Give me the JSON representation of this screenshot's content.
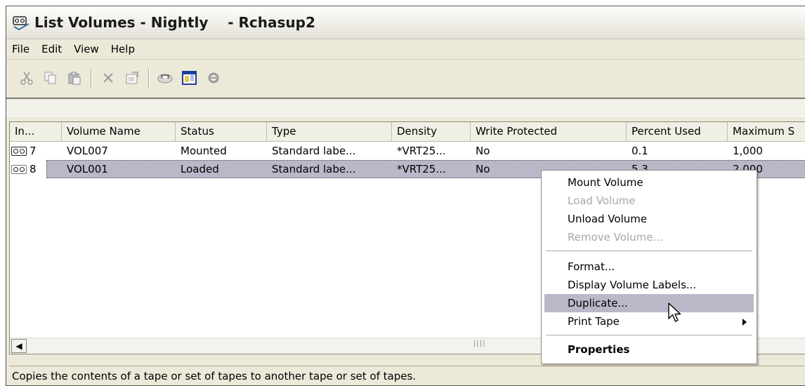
{
  "window": {
    "title": "List Volumes - Nightly    - Rchasup2"
  },
  "menu": [
    {
      "label": "File"
    },
    {
      "label": "Edit"
    },
    {
      "label": "View"
    },
    {
      "label": "Help"
    }
  ],
  "toolbar": {
    "buttons": [
      {
        "icon": "cut-icon"
      },
      {
        "icon": "copy-icon"
      },
      {
        "icon": "paste-icon"
      },
      {
        "icon": "delete-icon"
      },
      {
        "icon": "properties-icon"
      },
      {
        "icon": "tape-icon"
      },
      {
        "icon": "columns-icon"
      },
      {
        "icon": "stop-icon"
      }
    ]
  },
  "table": {
    "columns": [
      {
        "label": "In..."
      },
      {
        "label": "Volume Name"
      },
      {
        "label": "Status"
      },
      {
        "label": "Type"
      },
      {
        "label": "Density"
      },
      {
        "label": "Write Protected"
      },
      {
        "label": "Percent Used"
      },
      {
        "label": "Maximum S"
      }
    ],
    "rows": [
      {
        "index": "7",
        "volume": "VOL007",
        "status": "Mounted",
        "type": "Standard labe...",
        "density": "*VRT25...",
        "write_protected": "No",
        "percent_used": "0.1",
        "maximum": "1,000"
      },
      {
        "index": "8",
        "volume": "VOL001",
        "status": "Loaded",
        "type": "Standard labe...",
        "density": "*VRT25...",
        "write_protected": "No",
        "percent_used": "5.3",
        "maximum": "2,000"
      }
    ],
    "selected_row": 1
  },
  "context_menu": {
    "group1": [
      {
        "label": "Mount Volume",
        "enabled": true
      },
      {
        "label": "Load Volume",
        "enabled": false
      },
      {
        "label": "Unload Volume",
        "enabled": true
      },
      {
        "label": "Remove Volume...",
        "enabled": false
      }
    ],
    "group2": [
      {
        "label": "Format...",
        "enabled": true
      },
      {
        "label": "Display Volume Labels...",
        "enabled": true
      },
      {
        "label": "Duplicate...",
        "enabled": true,
        "highlighted": true
      },
      {
        "label": "Print Tape",
        "enabled": true,
        "submenu": true
      }
    ],
    "group3": [
      {
        "label": "Properties",
        "enabled": true,
        "bold": true
      }
    ]
  },
  "status_bar": {
    "text": "Copies the contents of a tape or set of tapes to another tape or set of tapes."
  },
  "colors": {
    "selection": "#b9b8c8",
    "chrome": "#ece9d8",
    "disabled_text": "#a7a7a7"
  }
}
